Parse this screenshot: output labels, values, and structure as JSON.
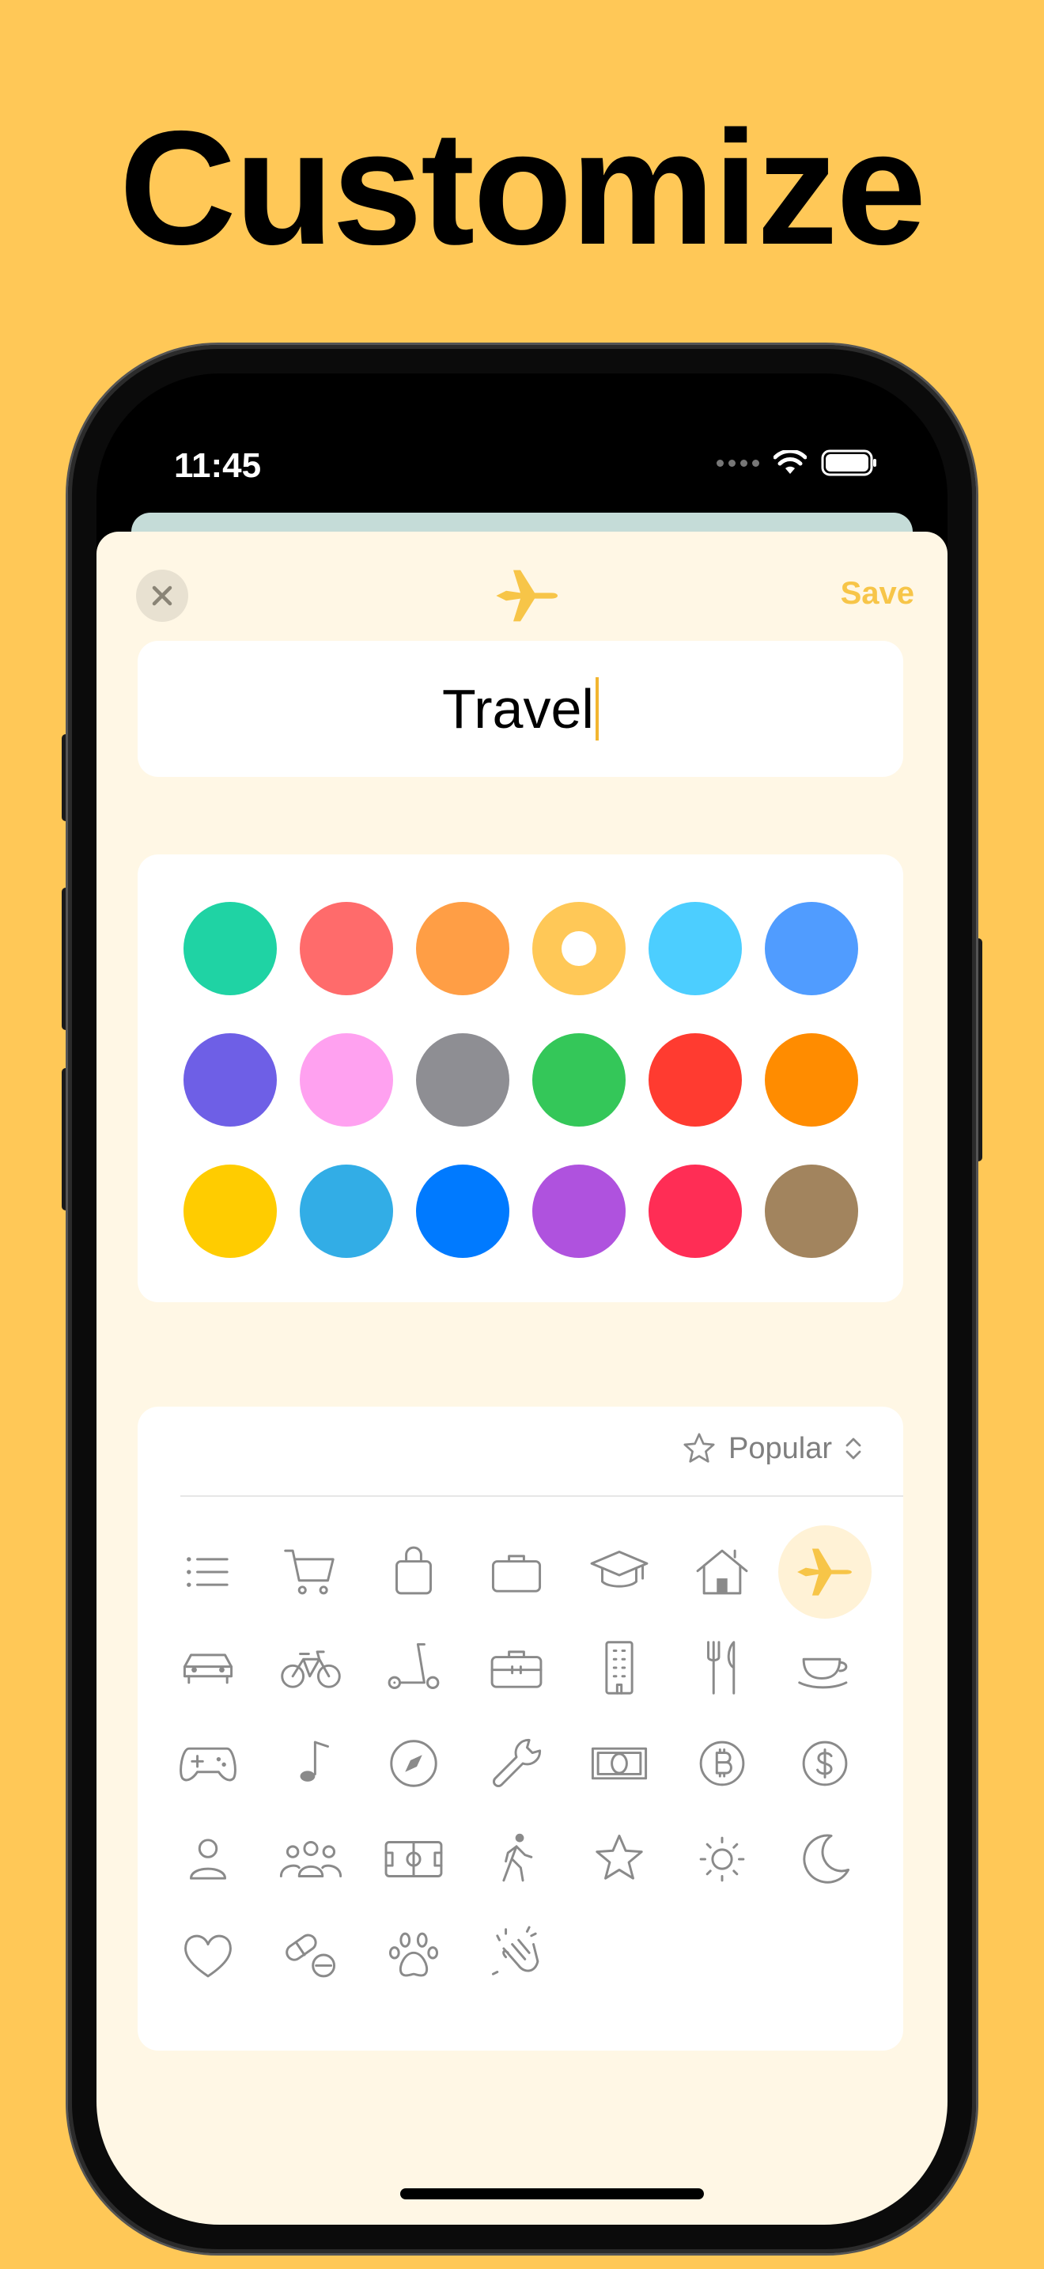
{
  "headline": "Customize",
  "status_bar": {
    "time": "11:45"
  },
  "sheet": {
    "save_label": "Save",
    "header_icon": "airplane-icon",
    "name_value": "Travel",
    "picker_label": "Popular"
  },
  "colors": [
    {
      "name": "mint",
      "hex": "#1FD3A4"
    },
    {
      "name": "coral",
      "hex": "#FF6B6B"
    },
    {
      "name": "orange",
      "hex": "#FF9E45"
    },
    {
      "name": "yellow-selected",
      "hex": "#FFC857",
      "selected": true
    },
    {
      "name": "sky",
      "hex": "#4CCEFF"
    },
    {
      "name": "blue",
      "hex": "#509CFF"
    },
    {
      "name": "indigo",
      "hex": "#6E5FE6"
    },
    {
      "name": "pink",
      "hex": "#FFA1F0"
    },
    {
      "name": "gray",
      "hex": "#8E8E93"
    },
    {
      "name": "green",
      "hex": "#34C759"
    },
    {
      "name": "red",
      "hex": "#FF3B30"
    },
    {
      "name": "amber",
      "hex": "#FF8C00"
    },
    {
      "name": "gold",
      "hex": "#FFCC00"
    },
    {
      "name": "cyan",
      "hex": "#32ADE6"
    },
    {
      "name": "system-blue",
      "hex": "#007AFF"
    },
    {
      "name": "purple",
      "hex": "#AF52DE"
    },
    {
      "name": "rose",
      "hex": "#FF2D55"
    },
    {
      "name": "brown",
      "hex": "#A2845E"
    }
  ],
  "icons": [
    "list-icon",
    "cart-icon",
    "bag-icon",
    "briefcase-icon",
    "graduation-cap-icon",
    "house-icon",
    "airplane-icon",
    "car-icon",
    "bicycle-icon",
    "scooter-icon",
    "toolbox-icon",
    "building-icon",
    "fork-knife-icon",
    "cup-icon",
    "gamecontroller-icon",
    "music-note-icon",
    "compass-icon",
    "wrench-icon",
    "banknote-icon",
    "bitcoin-icon",
    "dollar-icon",
    "person-icon",
    "people-icon",
    "field-icon",
    "walking-icon",
    "star-icon",
    "sun-icon",
    "moon-icon",
    "heart-icon",
    "pills-icon",
    "pawprint-icon",
    "clapping-hands-icon"
  ],
  "accent": "#F7C548"
}
